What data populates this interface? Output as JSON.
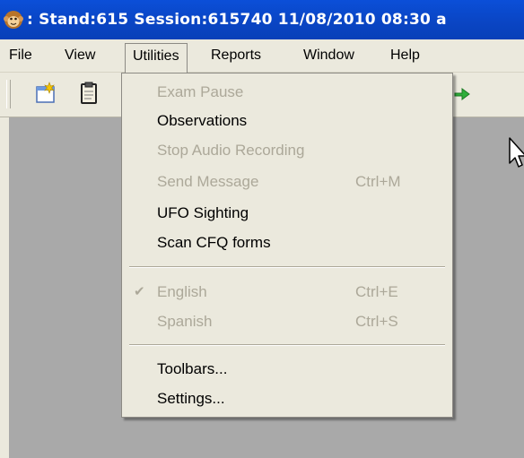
{
  "window": {
    "title": ": Stand:615 Session:615740 11/08/2010 08:30 a",
    "app_icon": "monkey-face-icon"
  },
  "menubar": {
    "items": [
      {
        "label": "File"
      },
      {
        "label": "View"
      },
      {
        "label": "Utilities",
        "active": true
      },
      {
        "label": "Reports"
      },
      {
        "label": "Window"
      },
      {
        "label": "Help"
      }
    ]
  },
  "toolbar": {
    "buttons": [
      {
        "icon": "new-document-icon"
      },
      {
        "icon": "clipboard-icon"
      },
      {
        "icon": "green-arrow-icon"
      }
    ]
  },
  "utilities_menu": {
    "items": [
      {
        "label": "Exam Pause",
        "enabled": false,
        "shortcut": ""
      },
      {
        "label": "Observations",
        "enabled": true,
        "shortcut": ""
      },
      {
        "label": "Stop Audio Recording",
        "enabled": false,
        "shortcut": ""
      },
      {
        "label": "Send Message",
        "enabled": false,
        "shortcut": "Ctrl+M"
      },
      {
        "label": "UFO Sighting",
        "enabled": true,
        "shortcut": ""
      },
      {
        "label": "Scan CFQ forms",
        "enabled": true,
        "shortcut": ""
      },
      {
        "label": "English",
        "enabled": false,
        "shortcut": "Ctrl+E",
        "checked": true
      },
      {
        "label": "Spanish",
        "enabled": false,
        "shortcut": "Ctrl+S"
      },
      {
        "label": "Toolbars...",
        "enabled": true,
        "shortcut": ""
      },
      {
        "label": "Settings...",
        "enabled": true,
        "shortcut": ""
      }
    ]
  },
  "colors": {
    "titlebar": "#0a46c6",
    "menu_background": "#ebe9dd",
    "disabled_text": "#aca899",
    "workspace": "#a9a9a9"
  }
}
